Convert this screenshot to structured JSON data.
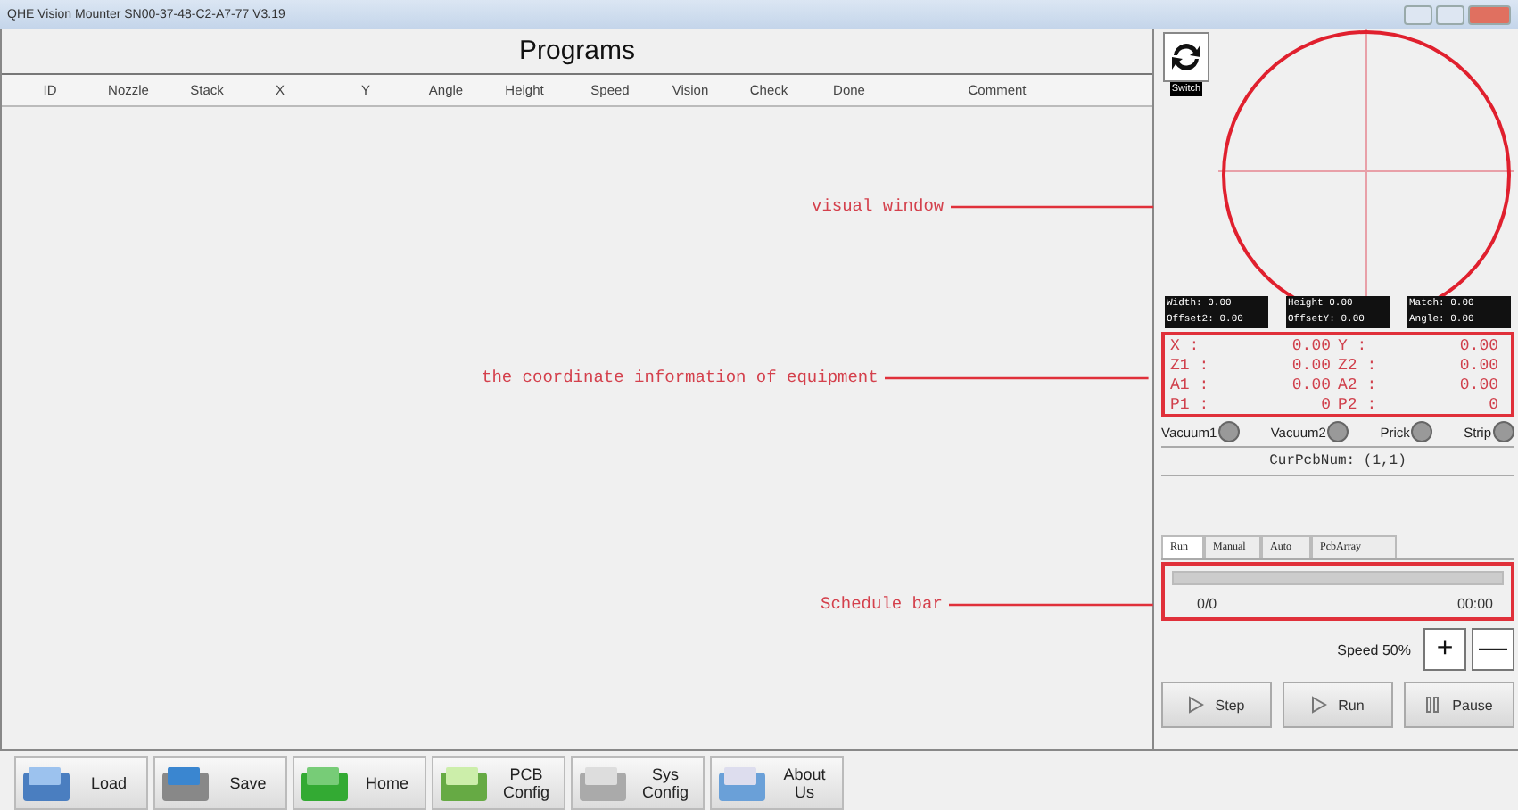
{
  "window": {
    "title": "QHE Vision Mounter  SN00-37-48-C2-A7-77  V3.19"
  },
  "programs": {
    "title": "Programs",
    "columns": [
      "ID",
      "Nozzle",
      "Stack",
      "X",
      "Y",
      "Angle",
      "Height",
      "Speed",
      "Vision",
      "Check",
      "Done",
      "Comment"
    ]
  },
  "vision": {
    "switch_label": "Switch",
    "readouts": [
      {
        "label": "Width:",
        "value": "0.00"
      },
      {
        "label": "Height",
        "value": "0.00"
      },
      {
        "label": "Match:",
        "value": "0.00"
      },
      {
        "label": "Offset2:",
        "value": "0.00"
      },
      {
        "label": "OffsetY:",
        "value": "0.00"
      },
      {
        "label": "Angle:",
        "value": "0.00"
      }
    ]
  },
  "coordinates": [
    {
      "label": "X :",
      "value": "0.00"
    },
    {
      "label": "Y :",
      "value": "0.00"
    },
    {
      "label": "Z1 :",
      "value": "0.00"
    },
    {
      "label": "Z2 :",
      "value": "0.00"
    },
    {
      "label": "A1 :",
      "value": "0.00"
    },
    {
      "label": "A2 :",
      "value": "0.00"
    },
    {
      "label": "P1 :",
      "value": "0"
    },
    {
      "label": "P2 :",
      "value": "0"
    }
  ],
  "indicators": [
    {
      "label": "Vacuum1",
      "on": false
    },
    {
      "label": "Vacuum2",
      "on": false
    },
    {
      "label": "Prick",
      "on": false
    },
    {
      "label": "Strip",
      "on": false
    }
  ],
  "cur_pcb_num": "CurPcbNum: (1,1)",
  "tabs": [
    {
      "label": "Run",
      "selected": true
    },
    {
      "label": "Manual",
      "selected": false
    },
    {
      "label": "Auto",
      "selected": false
    },
    {
      "label": "PcbArray",
      "selected": false
    }
  ],
  "schedule": {
    "level": 0,
    "count": "0/0",
    "time": "00:00"
  },
  "speed": {
    "label": "Speed 50%",
    "plus": "+",
    "minus": "—"
  },
  "run_buttons": [
    {
      "kind": "play",
      "label": "Step"
    },
    {
      "kind": "play",
      "label": "Run"
    },
    {
      "kind": "pause",
      "label": "Pause"
    }
  ],
  "toolbar": [
    {
      "label": "Load"
    },
    {
      "label": "Save"
    },
    {
      "label": "Home"
    },
    {
      "label": "PCB Config"
    },
    {
      "label": "Sys Config"
    },
    {
      "label": "About Us"
    }
  ],
  "annotations": [
    "visual window",
    "the coordinate information of equipment",
    "Schedule bar"
  ]
}
